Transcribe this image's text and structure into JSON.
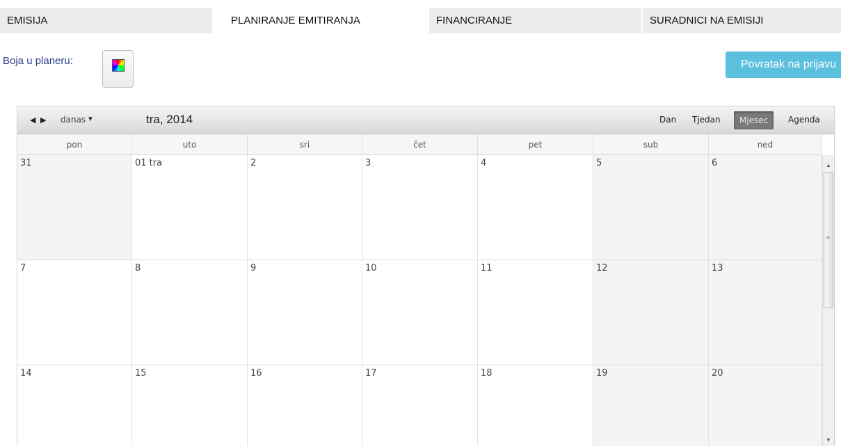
{
  "tabs": [
    {
      "label": "EMISIJA"
    },
    {
      "label": "PLANIRANJE EMITIRANJA"
    },
    {
      "label": "FINANCIRANJE"
    },
    {
      "label": "SURADNICI NA EMISIJI"
    }
  ],
  "color": {
    "label": "Boja u planeru:"
  },
  "return_button": {
    "label": "Povratak na prijavu"
  },
  "calendar": {
    "title": "tra, 2014",
    "today": "danas",
    "views": [
      {
        "label": "Dan"
      },
      {
        "label": "Tjedan"
      },
      {
        "label": "Mjesec"
      },
      {
        "label": "Agenda"
      }
    ],
    "active_view": "Mjesec",
    "days": [
      "pon",
      "uto",
      "sri",
      "čet",
      "pet",
      "sub",
      "ned"
    ],
    "weeks": [
      [
        "31",
        "01 tra",
        "2",
        "3",
        "4",
        "5",
        "6"
      ],
      [
        "7",
        "8",
        "9",
        "10",
        "11",
        "12",
        "13"
      ],
      [
        "14",
        "15",
        "16",
        "17",
        "18",
        "19",
        "20"
      ]
    ]
  },
  "colors": {
    "accent": "#5bc0de",
    "label_blue": "#2b3f8a"
  },
  "icons": {
    "prev": "triangle-left-icon",
    "next": "triangle-right-icon",
    "dropdown": "caret-down-icon",
    "swatch": "color-spectrum-icon"
  }
}
